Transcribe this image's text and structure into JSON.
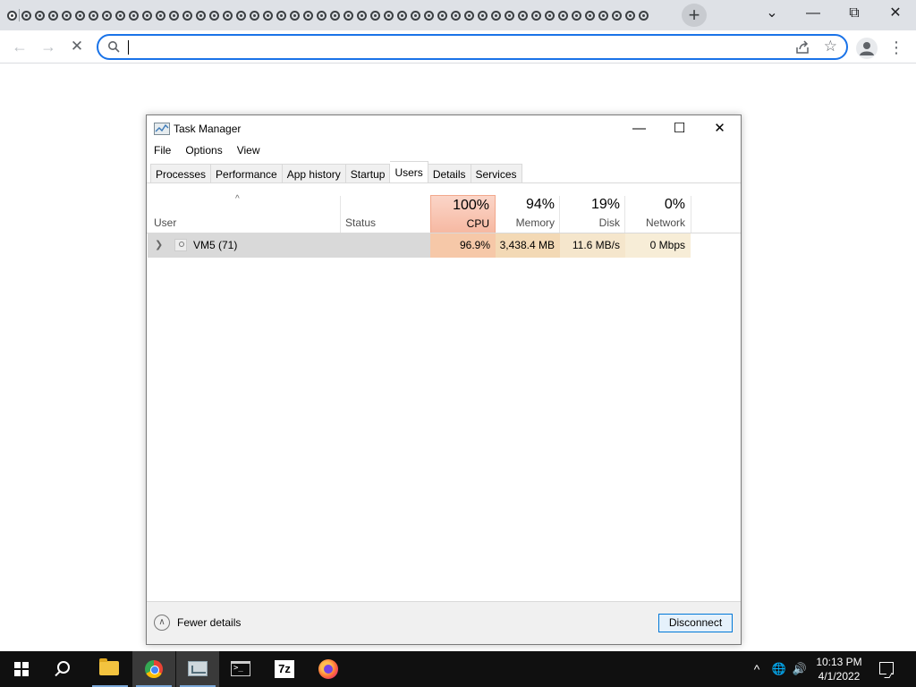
{
  "browser": {
    "tab_count": 48,
    "new_tab_glyph": "+",
    "omnibox": {
      "value": "",
      "placeholder": ""
    },
    "controls": {
      "tab_search": "⌄",
      "minimize": "—",
      "restore": "⧉",
      "close": "✕"
    },
    "nav": {
      "back": "←",
      "forward": "→",
      "stop": "✕"
    },
    "star": "☆",
    "menu": "⋮"
  },
  "task_manager": {
    "title": "Task Manager",
    "controls": {
      "minimize": "—",
      "maximize": "☐",
      "close": "✕"
    },
    "menu": [
      "File",
      "Options",
      "View"
    ],
    "tabs": [
      "Processes",
      "Performance",
      "App history",
      "Startup",
      "Users",
      "Details",
      "Services"
    ],
    "active_tab": "Users",
    "sort_caret": "^",
    "columns": {
      "user": "User",
      "status": "Status",
      "cpu": {
        "pct": "100%",
        "label": "CPU"
      },
      "memory": {
        "pct": "94%",
        "label": "Memory"
      },
      "disk": {
        "pct": "19%",
        "label": "Disk"
      },
      "network": {
        "pct": "0%",
        "label": "Network"
      }
    },
    "rows": [
      {
        "user": "VM5 (71)",
        "status": "",
        "cpu": "96.9%",
        "memory": "3,438.4 MB",
        "disk": "11.6 MB/s",
        "network": "0 Mbps"
      }
    ],
    "footer": {
      "fewer_details": "Fewer details",
      "disconnect": "Disconnect"
    }
  },
  "taskbar": {
    "items": [
      "start-icon",
      "search-icon",
      "file-explorer-icon",
      "chrome-icon",
      "task-manager-icon",
      "command-prompt-icon",
      "7zip-icon",
      "firefox-icon"
    ],
    "sz_label": "7z",
    "cmd_label": ">_",
    "tray": {
      "chevron": "^",
      "network": "🌐",
      "volume": "🔊"
    },
    "clock": {
      "time": "10:13 PM",
      "date": "4/1/2022"
    }
  }
}
